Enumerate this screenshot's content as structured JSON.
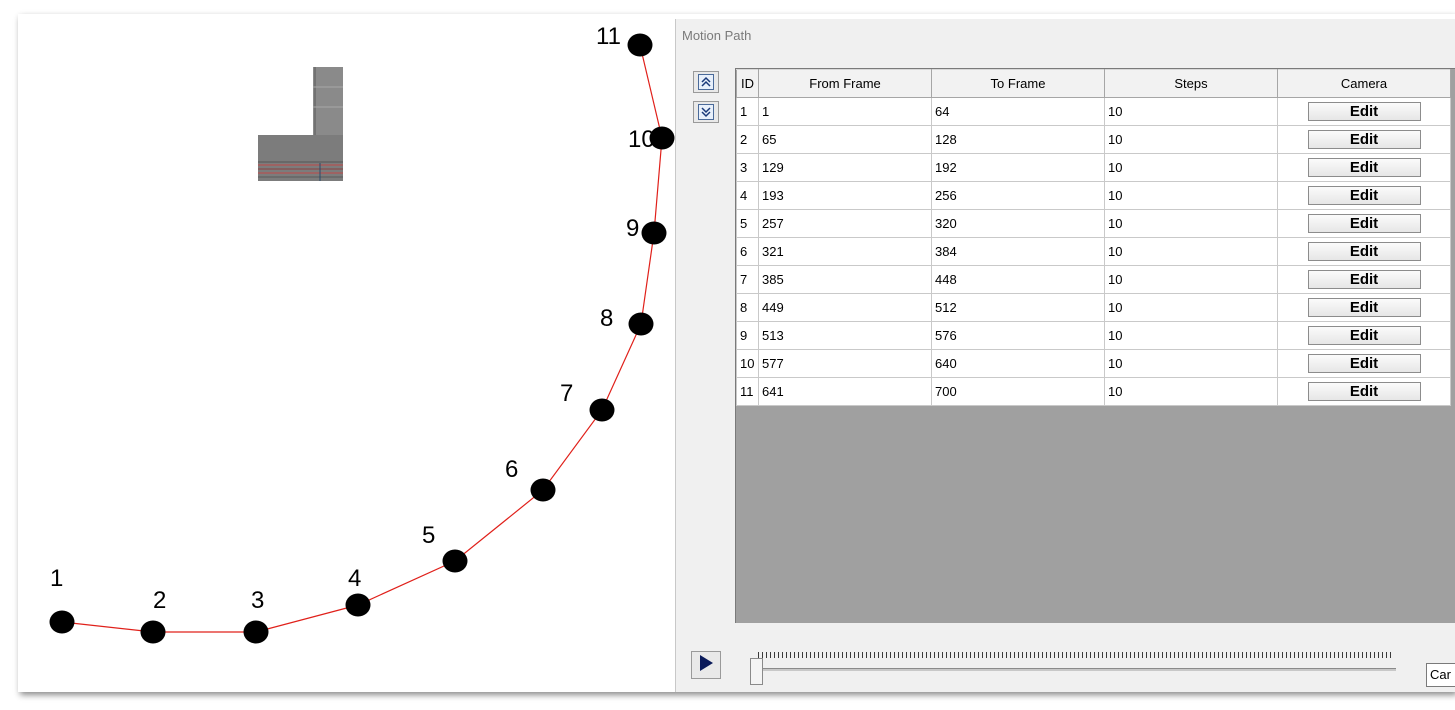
{
  "viewport": {
    "path_color": "#e0201a",
    "points": [
      "1",
      "2",
      "3",
      "4",
      "5",
      "6",
      "7",
      "8",
      "9",
      "10",
      "11"
    ]
  },
  "panel": {
    "title": "Motion Path",
    "nav": {
      "up_icon": "double-up-arrow-icon",
      "down_icon": "double-down-arrow-icon"
    },
    "columns": [
      "ID",
      "From Frame",
      "To Frame",
      "Steps",
      "Camera"
    ],
    "rows": [
      {
        "id": "1",
        "from": "1",
        "to": "64",
        "steps": "10",
        "camera": "Edit"
      },
      {
        "id": "2",
        "from": "65",
        "to": "128",
        "steps": "10",
        "camera": "Edit"
      },
      {
        "id": "3",
        "from": "129",
        "to": "192",
        "steps": "10",
        "camera": "Edit"
      },
      {
        "id": "4",
        "from": "193",
        "to": "256",
        "steps": "10",
        "camera": "Edit"
      },
      {
        "id": "5",
        "from": "257",
        "to": "320",
        "steps": "10",
        "camera": "Edit"
      },
      {
        "id": "6",
        "from": "321",
        "to": "384",
        "steps": "10",
        "camera": "Edit"
      },
      {
        "id": "7",
        "from": "385",
        "to": "448",
        "steps": "10",
        "camera": "Edit"
      },
      {
        "id": "8",
        "from": "449",
        "to": "512",
        "steps": "10",
        "camera": "Edit"
      },
      {
        "id": "9",
        "from": "513",
        "to": "576",
        "steps": "10",
        "camera": "Edit"
      },
      {
        "id": "10",
        "from": "577",
        "to": "640",
        "steps": "10",
        "camera": "Edit"
      },
      {
        "id": "11",
        "from": "641",
        "to": "700",
        "steps": "10",
        "camera": "Edit"
      }
    ],
    "play_icon": "play-icon",
    "slider_value": 0,
    "camera_field": "Car"
  }
}
